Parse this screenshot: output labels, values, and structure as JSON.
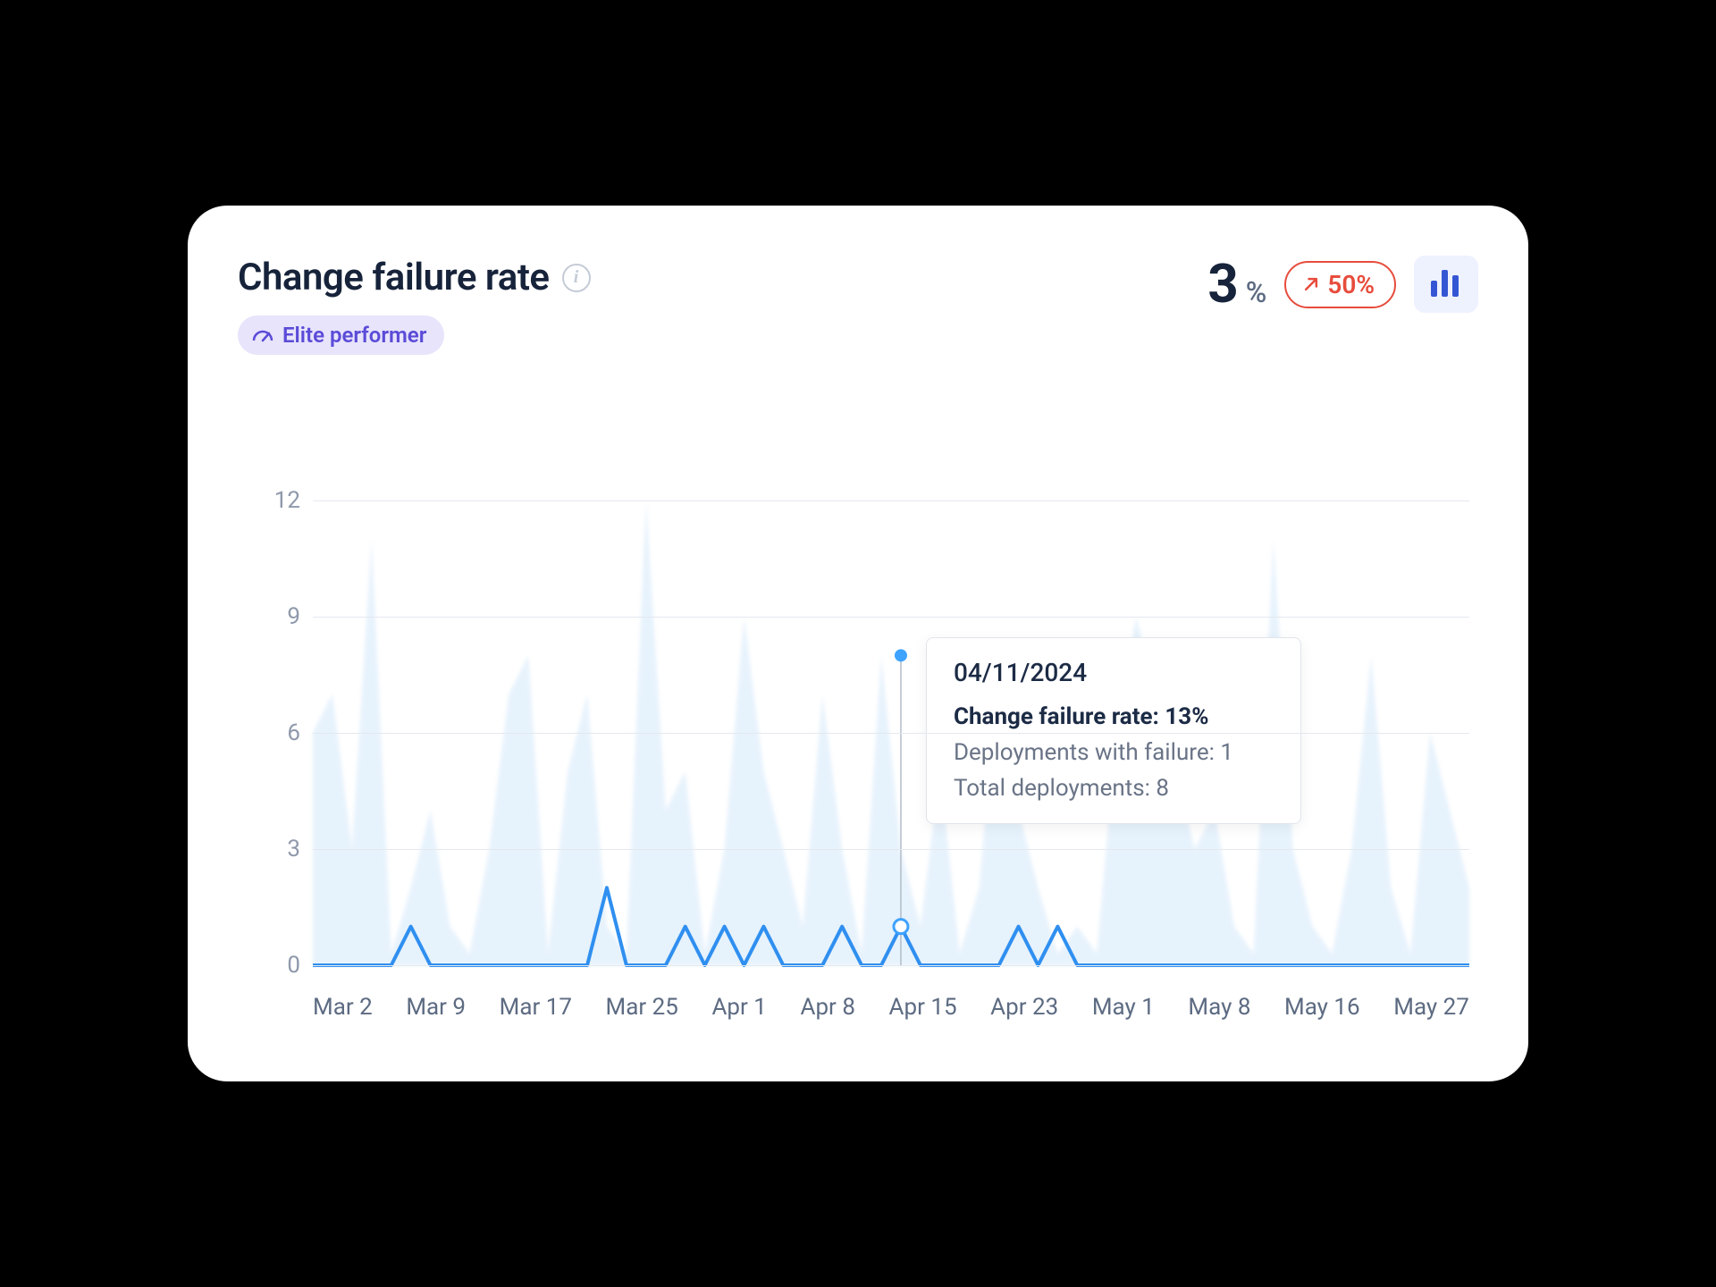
{
  "header": {
    "title": "Change failure rate",
    "badge_label": "Elite performer",
    "metric_value": "3",
    "metric_unit": "%",
    "trend_value": "50%"
  },
  "tooltip": {
    "date": "04/11/2024",
    "row1_label": "Change failure rate:",
    "row1_value": "13%",
    "row2_label": "Deployments with failure:",
    "row2_value": "1",
    "row3_label": "Total deployments:",
    "row3_value": "8"
  },
  "chart_data": {
    "type": "area",
    "title": "Change failure rate",
    "ylabel": "",
    "xlabel": "",
    "ylim": [
      0,
      12
    ],
    "y_ticks": [
      0,
      3,
      6,
      9,
      12
    ],
    "x_tick_labels": [
      "Mar 2",
      "Mar 9",
      "Mar 17",
      "Mar 25",
      "Apr 1",
      "Apr 8",
      "Apr 15",
      "Apr 23",
      "May 1",
      "May 8",
      "May 16",
      "May 27"
    ],
    "series": [
      {
        "name": "Total deployments",
        "style": "area",
        "color": "#d3e8fa",
        "values": [
          6,
          7,
          3,
          11,
          0.3,
          2,
          4,
          1,
          0.3,
          3,
          7,
          8,
          0.3,
          5,
          7,
          1,
          0.3,
          12,
          4,
          5,
          0.3,
          3,
          9,
          5,
          3,
          1,
          7,
          3,
          0.3,
          8,
          3,
          1,
          5,
          0.3,
          2,
          8,
          4,
          2,
          0.3,
          1,
          0.3,
          6,
          9,
          7,
          5,
          3,
          4,
          1,
          0.3,
          11,
          3,
          1,
          0.3,
          3,
          8,
          2,
          0.3,
          6,
          4,
          2
        ]
      },
      {
        "name": "Deployments with failure",
        "style": "line",
        "color": "#2f8ff0",
        "values": [
          0,
          0,
          0,
          0,
          0,
          1,
          0,
          0,
          0,
          0,
          0,
          0,
          0,
          0,
          0,
          2,
          0,
          0,
          0,
          1,
          0,
          1,
          0,
          1,
          0,
          0,
          0,
          1,
          0,
          0,
          1,
          0,
          0,
          0,
          0,
          0,
          1,
          0,
          1,
          0,
          0,
          0,
          0,
          0,
          0,
          0,
          0,
          0,
          0,
          0,
          0,
          0,
          0,
          0,
          0,
          0,
          0,
          0,
          0,
          0
        ]
      }
    ],
    "hover_index": 30,
    "hover_point_total": 8,
    "hover_point_failures": 1
  }
}
